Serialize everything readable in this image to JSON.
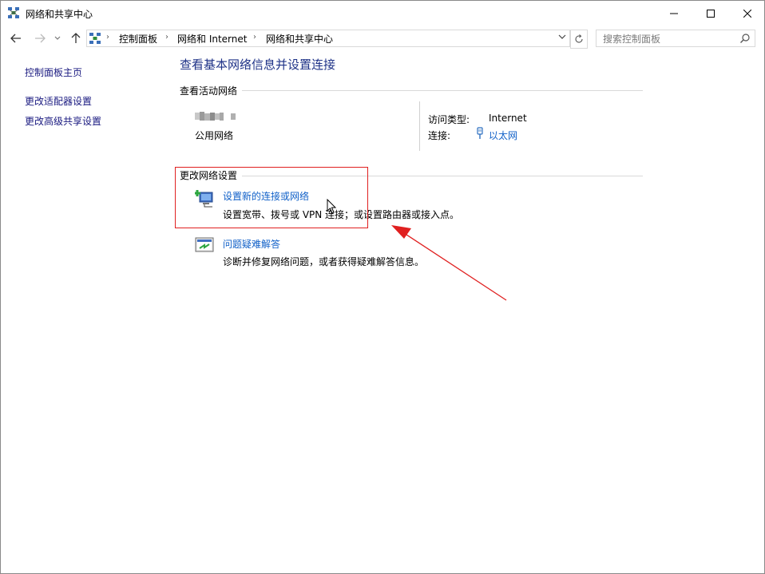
{
  "window": {
    "title": "网络和共享中心"
  },
  "address_bar": {
    "crumbs": [
      "控制面板",
      "网络和 Internet",
      "网络和共享中心"
    ]
  },
  "search": {
    "placeholder": "搜索控制面板"
  },
  "sidebar": {
    "items": [
      {
        "label": "控制面板主页"
      },
      {
        "label": "更改适配器设置"
      },
      {
        "label": "更改高级共享设置"
      }
    ]
  },
  "main": {
    "title": "查看基本网络信息并设置连接",
    "active_networks": {
      "heading": "查看活动网络",
      "network_type": "公用网络",
      "access_type_label": "访问类型:",
      "access_type_value": "Internet",
      "connections_label": "连接:",
      "connections_value": "以太网"
    },
    "change_settings": {
      "heading": "更改网络设置",
      "tasks": [
        {
          "link": "设置新的连接或网络",
          "desc": "设置宽带、拨号或 VPN 连接；或设置路由器或接入点。"
        },
        {
          "link": "问题疑难解答",
          "desc": "诊断并修复网络问题，或者获得疑难解答信息。"
        }
      ]
    }
  },
  "colors": {
    "title_blue": "#1e3287",
    "link_blue": "#1060c8",
    "annotation_red": "#e02020"
  }
}
